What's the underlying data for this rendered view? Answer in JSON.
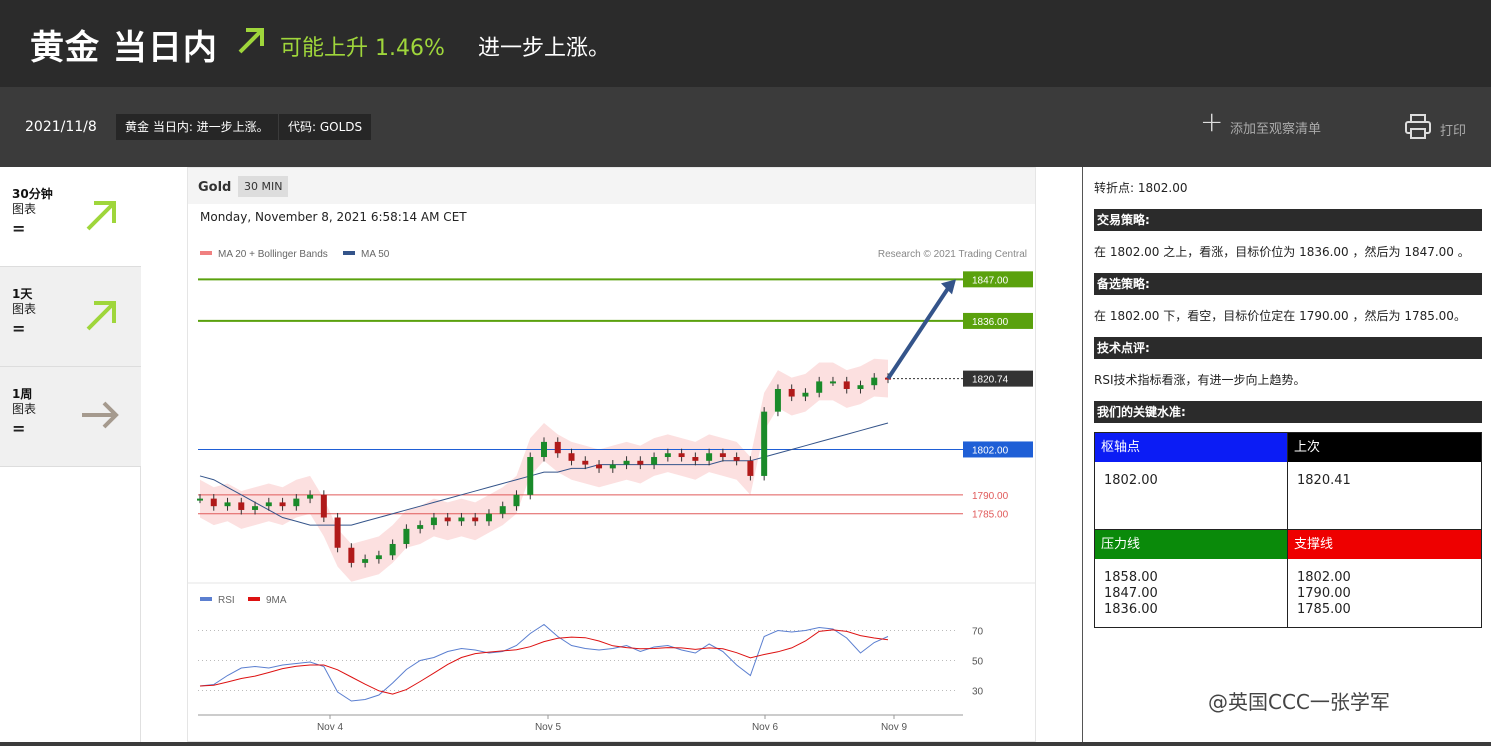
{
  "header": {
    "title": "黄金 当日内",
    "prediction": "可能上升 1.46%",
    "prediction_tail": "进一步上涨。",
    "accent": "#9fd63b"
  },
  "subbar": {
    "date": "2021/11/8",
    "chip_title": "黄金 当日内: 进一步上涨。",
    "chip_code": "代码: GOLDS",
    "watchlist": "添加至观察清单",
    "print": "打印"
  },
  "timeframes": [
    {
      "label": "30分钟",
      "sub": "图表",
      "eq": "=",
      "icon": "up-right-arrow-icon",
      "color": "#9fd63b"
    },
    {
      "label": "1天",
      "sub": "图表",
      "eq": "=",
      "icon": "up-right-arrow-icon",
      "color": "#9fd63b"
    },
    {
      "label": "1周",
      "sub": "图表",
      "eq": "=",
      "icon": "right-arrow-icon",
      "color": "#a59a8e"
    }
  ],
  "chart_header": {
    "instrument": "Gold",
    "interval": "30 MIN",
    "timestamp": "Monday, November 8, 2021 6:58:14 AM CET",
    "legend_ma20": "MA 20 + Bollinger Bands",
    "legend_ma50": "MA 50",
    "credit": "Research © 2021 Trading Central",
    "rsi_legend": "RSI",
    "rsi_ma_legend": "9MA"
  },
  "chart_data": {
    "type": "line",
    "title": "Gold",
    "x_tick_labels": [
      "Nov 4",
      "Nov 5",
      "Nov 6",
      "Nov 9"
    ],
    "levels": [
      {
        "label": "1847.00",
        "value": 1847.0,
        "color": "#5aa10d"
      },
      {
        "label": "1836.00",
        "value": 1836.0,
        "color": "#5aa10d"
      },
      {
        "label": "1820.74",
        "value": 1820.74,
        "color": "#333333"
      },
      {
        "label": "1802.00",
        "value": 1802.0,
        "color": "#1f5fd6"
      },
      {
        "label": "1790.00",
        "value": 1790.0,
        "color": "#e05a5a"
      },
      {
        "label": "1785.00",
        "value": 1785.0,
        "color": "#e05a5a"
      }
    ],
    "price_series": [
      1789,
      1787,
      1788,
      1786,
      1787,
      1788,
      1787,
      1789,
      1790,
      1784,
      1776,
      1772,
      1773,
      1774,
      1777,
      1781,
      1782,
      1784,
      1783,
      1784,
      1783,
      1785,
      1787,
      1790,
      1800,
      1804,
      1801,
      1799,
      1798,
      1797,
      1798,
      1799,
      1798,
      1800,
      1801,
      1800,
      1799,
      1801,
      1800,
      1799,
      1795,
      1812,
      1818,
      1816,
      1817,
      1820,
      1820,
      1818,
      1819,
      1821,
      1820.74
    ],
    "ma50_series": [
      1795,
      1794,
      1792,
      1790,
      1788,
      1786,
      1784,
      1783,
      1782,
      1782,
      1782,
      1782,
      1783,
      1784,
      1785,
      1786,
      1787,
      1788,
      1789,
      1790,
      1791,
      1792,
      1793,
      1794,
      1795,
      1796,
      1796,
      1797,
      1797,
      1798,
      1798,
      1798,
      1798,
      1798,
      1798,
      1798,
      1798,
      1798,
      1799,
      1799,
      1799,
      1800,
      1801,
      1802,
      1803,
      1804,
      1805,
      1806,
      1807,
      1808,
      1809
    ],
    "rsi_series": [
      33,
      34,
      40,
      45,
      46,
      45,
      47,
      48,
      49,
      46,
      29,
      23,
      24,
      27,
      35,
      44,
      50,
      52,
      56,
      58,
      57,
      55,
      56,
      60,
      68,
      74,
      66,
      60,
      58,
      57,
      58,
      60,
      56,
      59,
      60,
      57,
      55,
      61,
      56,
      47,
      40,
      66,
      70,
      69,
      70,
      72,
      71,
      65,
      55,
      62,
      66
    ],
    "rsi_ticks": [
      70,
      50,
      30
    ],
    "ylim": [
      1768,
      1850
    ],
    "grid": false
  },
  "right_panel": {
    "pivot_line": "转折点: 1802.00",
    "strategy_title": "交易策略:",
    "strategy_text": "在 1802.00 之上，看涨，目标价位为 1836.00 ，然后为 1847.00 。",
    "alt_title": "备选策略:",
    "alt_text": "在 1802.00 下，看空，目标价位定在 1790.00 ，然后为 1785.00。",
    "comment_title": "技术点评:",
    "comment_text": "RSI技术指标看涨，有进一步向上趋势。",
    "levels_title": "我们的关键水准:",
    "pivot_header": "枢轴点",
    "last_header": "上次",
    "pivot_value": "1802.00",
    "last_value": "1820.41",
    "resistance_header": "压力线",
    "support_header": "支撑线",
    "resistance_1": "1858.00",
    "resistance_2": "1847.00",
    "resistance_3": "1836.00",
    "support_1": "1802.00",
    "support_2": "1790.00",
    "support_3": "1785.00",
    "colors": {
      "pivot": "#0b1cf5",
      "last": "#000000",
      "resistance": "#0a8a0a",
      "support": "#ee0000"
    }
  },
  "watermark": "@英国CCC一张学军"
}
